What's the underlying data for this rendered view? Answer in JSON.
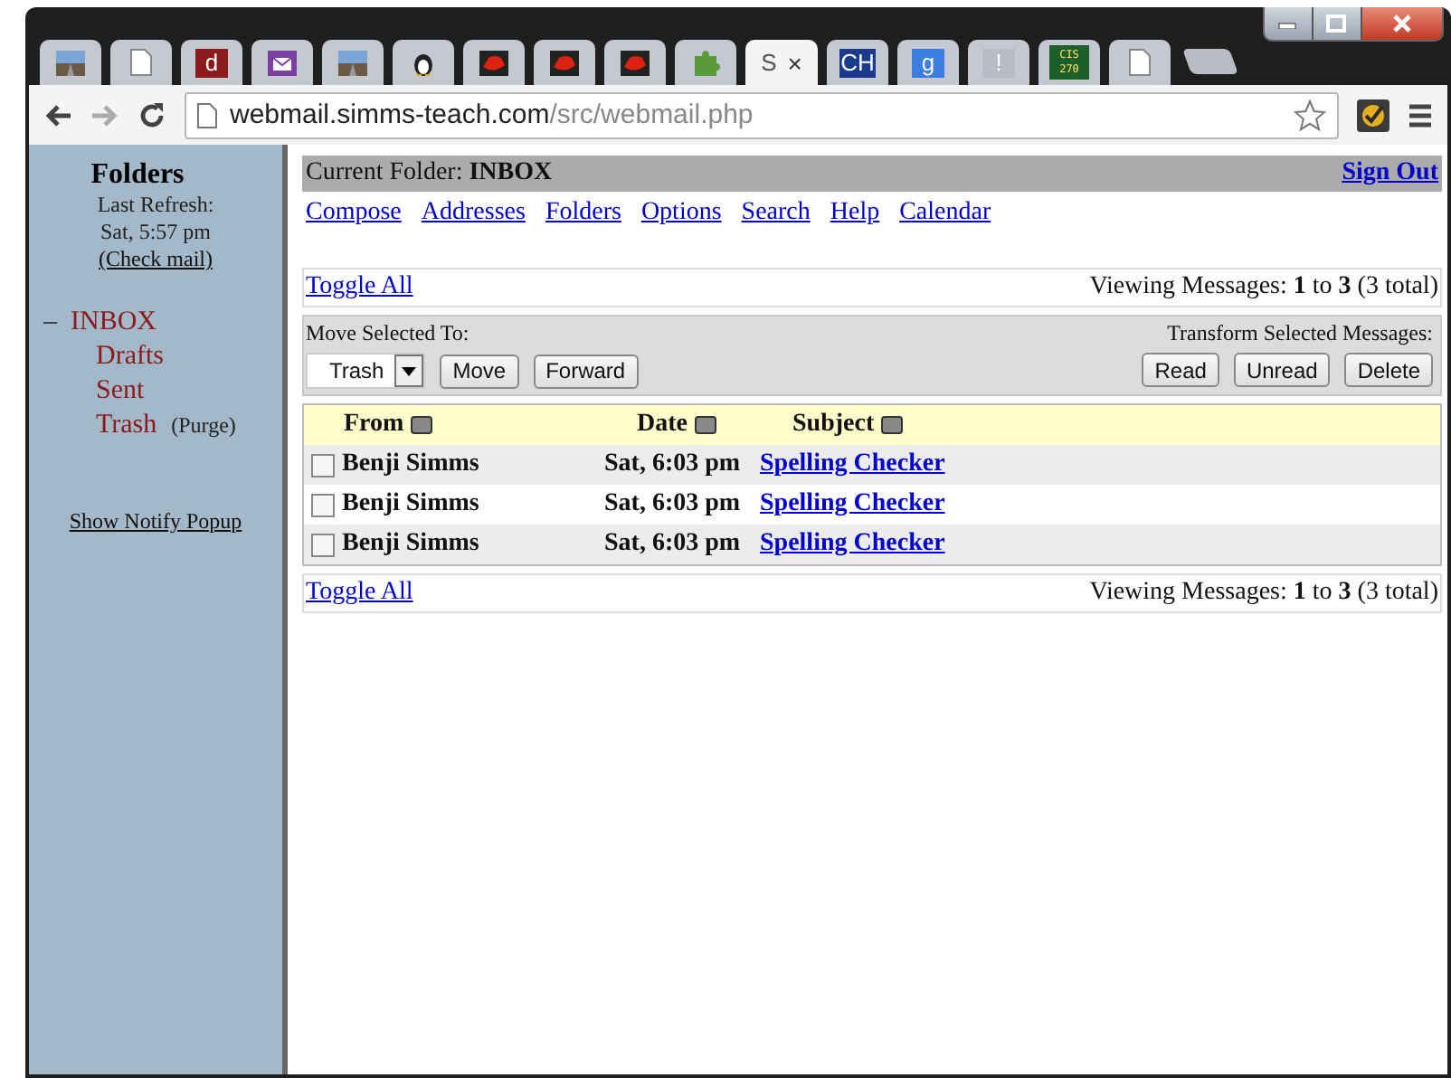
{
  "browser": {
    "tabs": [
      {
        "kind": "landscape",
        "selected": false
      },
      {
        "kind": "page",
        "selected": false
      },
      {
        "kind": "letter",
        "label": "d",
        "color": "#8b1a1a",
        "selected": false
      },
      {
        "kind": "mail",
        "selected": false
      },
      {
        "kind": "landscape",
        "selected": false
      },
      {
        "kind": "penguin",
        "selected": false
      },
      {
        "kind": "hat",
        "selected": false
      },
      {
        "kind": "hat",
        "selected": false
      },
      {
        "kind": "hat",
        "selected": false
      },
      {
        "kind": "puzzle",
        "selected": false
      },
      {
        "kind": "title",
        "label": "S",
        "close": "×",
        "selected": true
      },
      {
        "kind": "letter",
        "label": "CH",
        "color": "#1a3a8b",
        "selected": false
      },
      {
        "kind": "letter",
        "label": "g",
        "color": "#3b7de0",
        "selected": false
      },
      {
        "kind": "letter",
        "label": "!",
        "color": "#b8bcc4",
        "selected": false
      },
      {
        "kind": "letter",
        "label": "CIS 270",
        "color": "#1d5e2a",
        "selected": false
      },
      {
        "kind": "page",
        "selected": false
      }
    ],
    "url_host": "webmail.simms-teach.com",
    "url_path": "/src/webmail.php"
  },
  "sidebar": {
    "title": "Folders",
    "refresh_label": "Last Refresh:",
    "refresh_time": "Sat, 5:57 pm",
    "check_mail": "(Check mail)",
    "folders": [
      {
        "name": "INBOX",
        "toggle": "–",
        "children": [
          {
            "name": "Drafts"
          },
          {
            "name": "Sent"
          },
          {
            "name": "Trash",
            "action": "(Purge)"
          }
        ]
      }
    ],
    "notify": "Show Notify Popup"
  },
  "main": {
    "folder_label": "Current Folder:",
    "folder": "INBOX",
    "sign_out": "Sign Out",
    "nav": [
      "Compose",
      "Addresses",
      "Folders",
      "Options",
      "Search",
      "Help",
      "Calendar"
    ],
    "toggle_all": "Toggle All",
    "viewing": "Viewing Messages: **1** to **3** (3 total)",
    "move_label": "Move Selected To:",
    "move_target": "Trash",
    "move_button": "Move",
    "forward_button": "Forward",
    "transform_label": "Transform Selected Messages:",
    "transform_buttons": [
      "Read",
      "Unread",
      "Delete"
    ],
    "columns": [
      "From",
      "Date",
      "Subject"
    ],
    "messages": [
      {
        "checked": false,
        "from": "Benji Simms",
        "date": "Sat, 6:03 pm",
        "subject": "Spelling Checker"
      },
      {
        "checked": false,
        "from": "Benji Simms",
        "date": "Sat, 6:03 pm",
        "subject": "Spelling Checker"
      },
      {
        "checked": false,
        "from": "Benji Simms",
        "date": "Sat, 6:03 pm",
        "subject": "Spelling Checker"
      }
    ],
    "bottom_toggle_all": "Toggle All",
    "bottom_viewing": "Viewing Messages: **1** to **3** (3 total)"
  }
}
